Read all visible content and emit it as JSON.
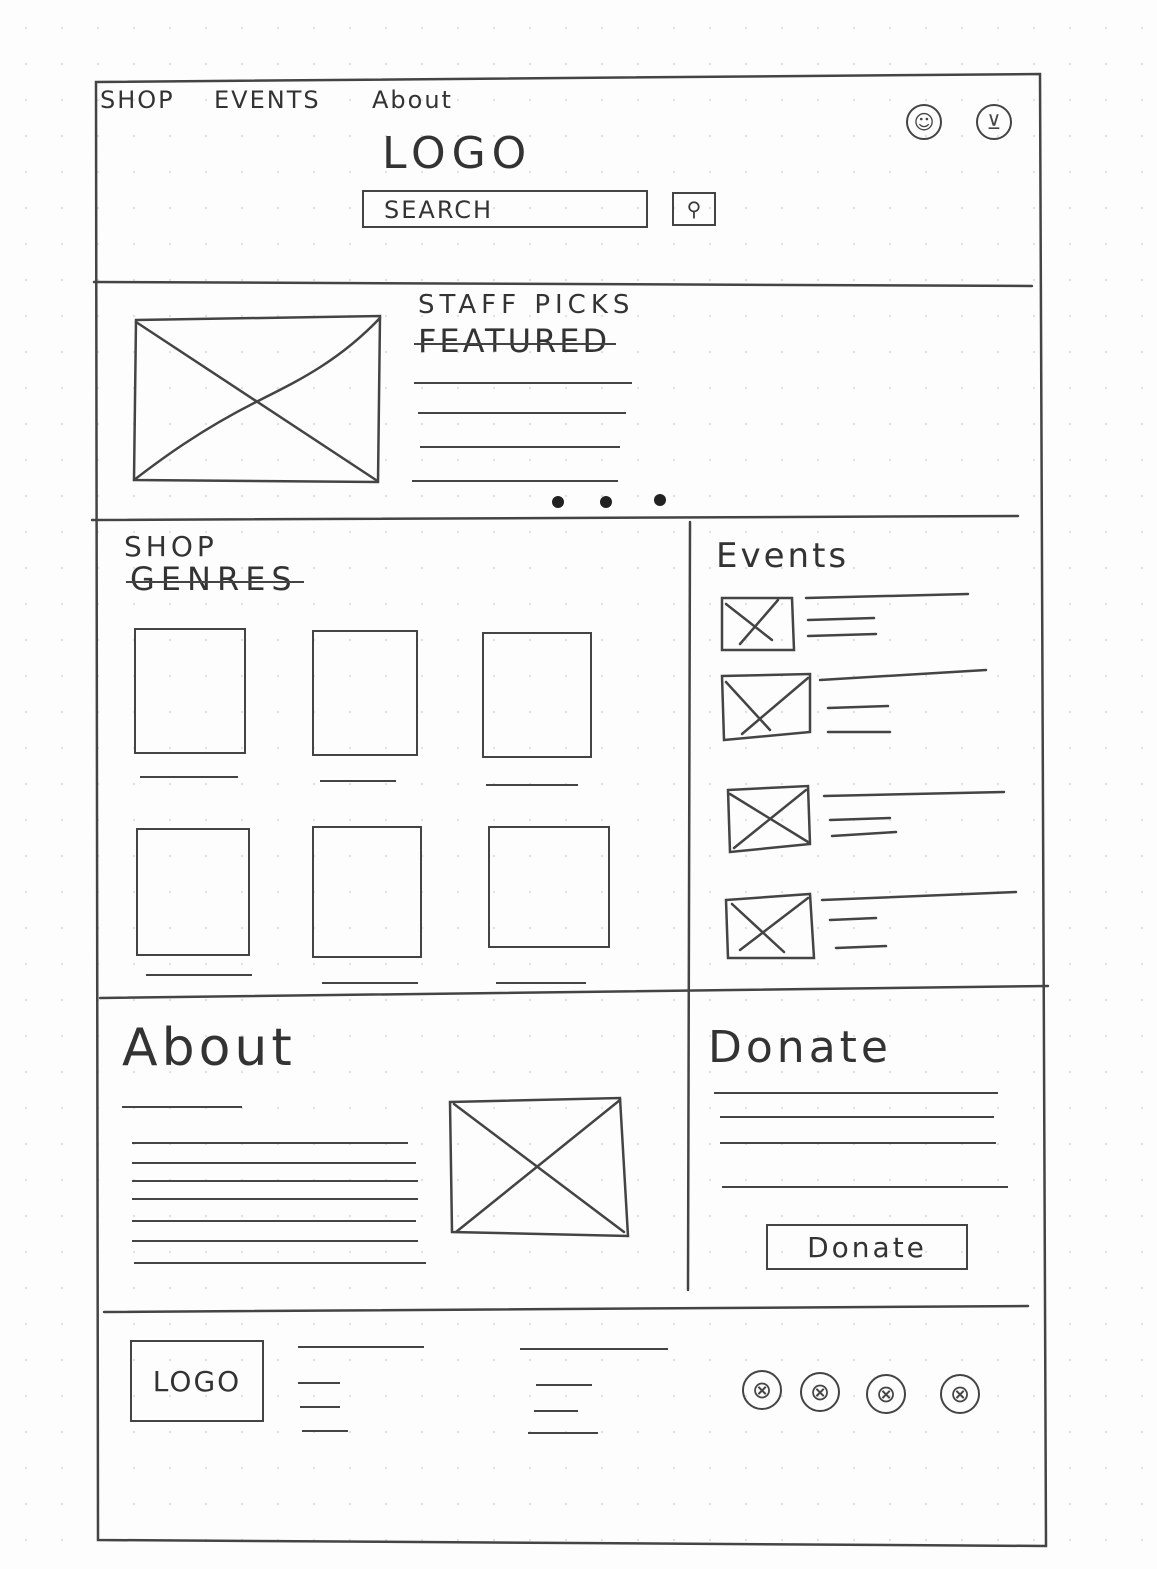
{
  "header": {
    "nav": [
      "SHOP",
      "EVENTS",
      "About"
    ],
    "logo": "LOGO",
    "search_placeholder": "SEARCH",
    "search_button_glyph": "⚲",
    "user_icon": "user-icon",
    "cart_icon": "cart-icon"
  },
  "featured": {
    "title": "STAFF PICKS",
    "struck_title": "FEATURED",
    "carousel_dots": 3
  },
  "shop": {
    "title": "SHOP",
    "struck_title": "GENRES",
    "tiles": 6
  },
  "events": {
    "title": "Events",
    "items": 4
  },
  "about": {
    "title": "About"
  },
  "donate": {
    "title": "Donate",
    "button_label": "Donate"
  },
  "footer": {
    "logo": "LOGO",
    "social_icons": [
      "social-icon-1",
      "social-icon-2",
      "social-icon-3",
      "social-icon-4"
    ],
    "social_glyph": "⊗"
  }
}
